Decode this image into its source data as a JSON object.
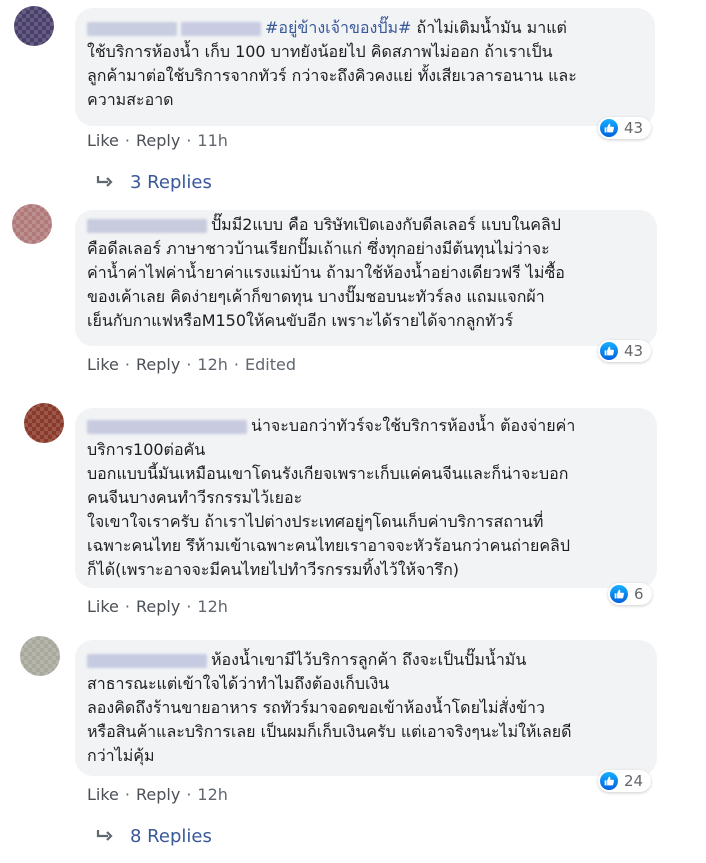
{
  "comments": [
    {
      "name_hidden": true,
      "hashtag": "#อยู่ข้างเจ้าของปั๊ม#",
      "lines": [
        " ถ้าไม่เติมน้ำมัน มาแต่",
        "ใช้บริการห้องน้ำ เก็บ 100 บาทยังน้อยไป คิดสภาพไม่ออก ถ้าเราเป็น",
        "ลูกค้ามาต่อใช้บริการจากทัวร์ กว่าจะถึงคิวคงแย่ ทั้งเสียเวลารอนาน และ",
        "ความสะอาด"
      ],
      "like": "Like",
      "reply": "Reply",
      "time": "11h",
      "edited": "",
      "reactions": "43",
      "replies": "3 Replies"
    },
    {
      "lines": [
        "ปั๊มมี2แบบ คือ บริษัทเปิดเองกับดีลเลอร์ แบบในคลิป",
        "คือดีลเลอร์ ภาษาชาวบ้านเรียกปั๊มเถ้าแก่ ซึ่งทุกอย่างมีต้นทุนไม่ว่าจะ",
        "ค่าน้ำค่าไฟค่าน้ำยาค่าแรงแม่บ้าน ถ้ามาใช้ห้องน้ำอย่างเดียวฟรี ไม่ซื้อ",
        "ของเค้าเลย คิดง่ายๆเค้าก็ขาดทุน บางปั๊มชอบนะทัวร์ลง แถมแจกผ้า",
        "เย็นกับกาแฟหรือM150ให้คนขับอีก เพราะได้รายได้จากลูกทัวร์"
      ],
      "like": "Like",
      "reply": "Reply",
      "time": "12h",
      "edited": "Edited",
      "reactions": "43"
    },
    {
      "lines": [
        "น่าจะบอกว่าทัวร์จะใช้บริการห้องน้ำ ต้องจ่ายค่า",
        "บริการ100ต่อคัน",
        "บอกแบบนี้มันเหมือนเขาโดนรังเกียจเพราะเก็บแค่คนจีนและก็น่าจะบอก",
        "คนจีนบางคนทำวีรกรรมไว้เยอะ",
        "ใจเขาใจเราครับ ถ้าเราไปต่างประเทศอยู่ๆโดนเก็บค่าบริการสถานที่",
        "เฉพาะคนไทย รึห้ามเข้าเฉพาะคนไทยเราอาจจะหัวร้อนกว่าคนถ่ายคลิป",
        "ก็ได้(เพราะอาจจะมีคนไทยไปทำวีรกรรมทิ้งไว้ให้จารึก)"
      ],
      "like": "Like",
      "reply": "Reply",
      "time": "12h",
      "edited": "",
      "reactions": "6"
    },
    {
      "lines": [
        "ห้องน้ำเขามีไว้บริการลูกค้า ถึงจะเป็นปั๊มน้ำมัน",
        "สาธารณะแต่เข้าใจได้ว่าทำไมถึงต้องเก็บเงิน",
        "ลองคิดถึงร้านขายอาหาร รถทัวร์มาจอดขอเข้าห้องน้ำโดยไม่สั่งข้าว",
        "หรือสินค้าและบริการเลย เป็นผมก็เก็บเงินครับ แต่เอาจริงๆนะไม่ให้เลยดี",
        "กว่าไม่คุ้ม"
      ],
      "like": "Like",
      "reply": "Reply",
      "time": "12h",
      "edited": "",
      "reactions": "24",
      "replies": "8 Replies"
    }
  ],
  "colors": {
    "bubble": "#f2f3f5",
    "link": "#385898",
    "meta": "#606770",
    "like_blue": "#1877f2"
  }
}
